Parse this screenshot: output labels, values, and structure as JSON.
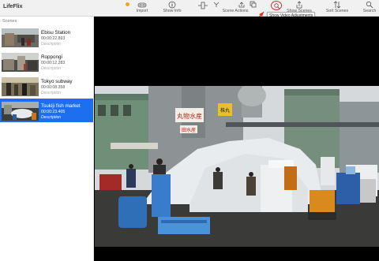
{
  "app": {
    "title": "LifeFlix"
  },
  "toolbar": {
    "import_label": "Import",
    "show_info_label": "Show Info",
    "scene_actions_label": "Scene Actions",
    "show_scenes_label": "Show Scenes",
    "sort_scenes_label": "Sort Scenes",
    "search_label": "Search",
    "tooltip": "Show Video Adjustments",
    "highlight_color": "#e3331f"
  },
  "sidebar": {
    "header": "Scenes",
    "scenes": [
      {
        "title": "Ebisu Station",
        "time": "00:00:22.893",
        "description": "Description"
      },
      {
        "title": "Roppongi",
        "time": "00:00:12.283",
        "description": "Description"
      },
      {
        "title": "Tokyo subway",
        "time": "00:00:08.358",
        "description": "Description"
      },
      {
        "title": "Tsukiji fish market",
        "time": "00:00:23.405",
        "description": "Description"
      }
    ],
    "selected_index": 3,
    "selected_color": "#1e6ff0"
  },
  "video": {
    "frame_signs": [
      "丸物水産",
      "株丸",
      "田水産"
    ]
  }
}
